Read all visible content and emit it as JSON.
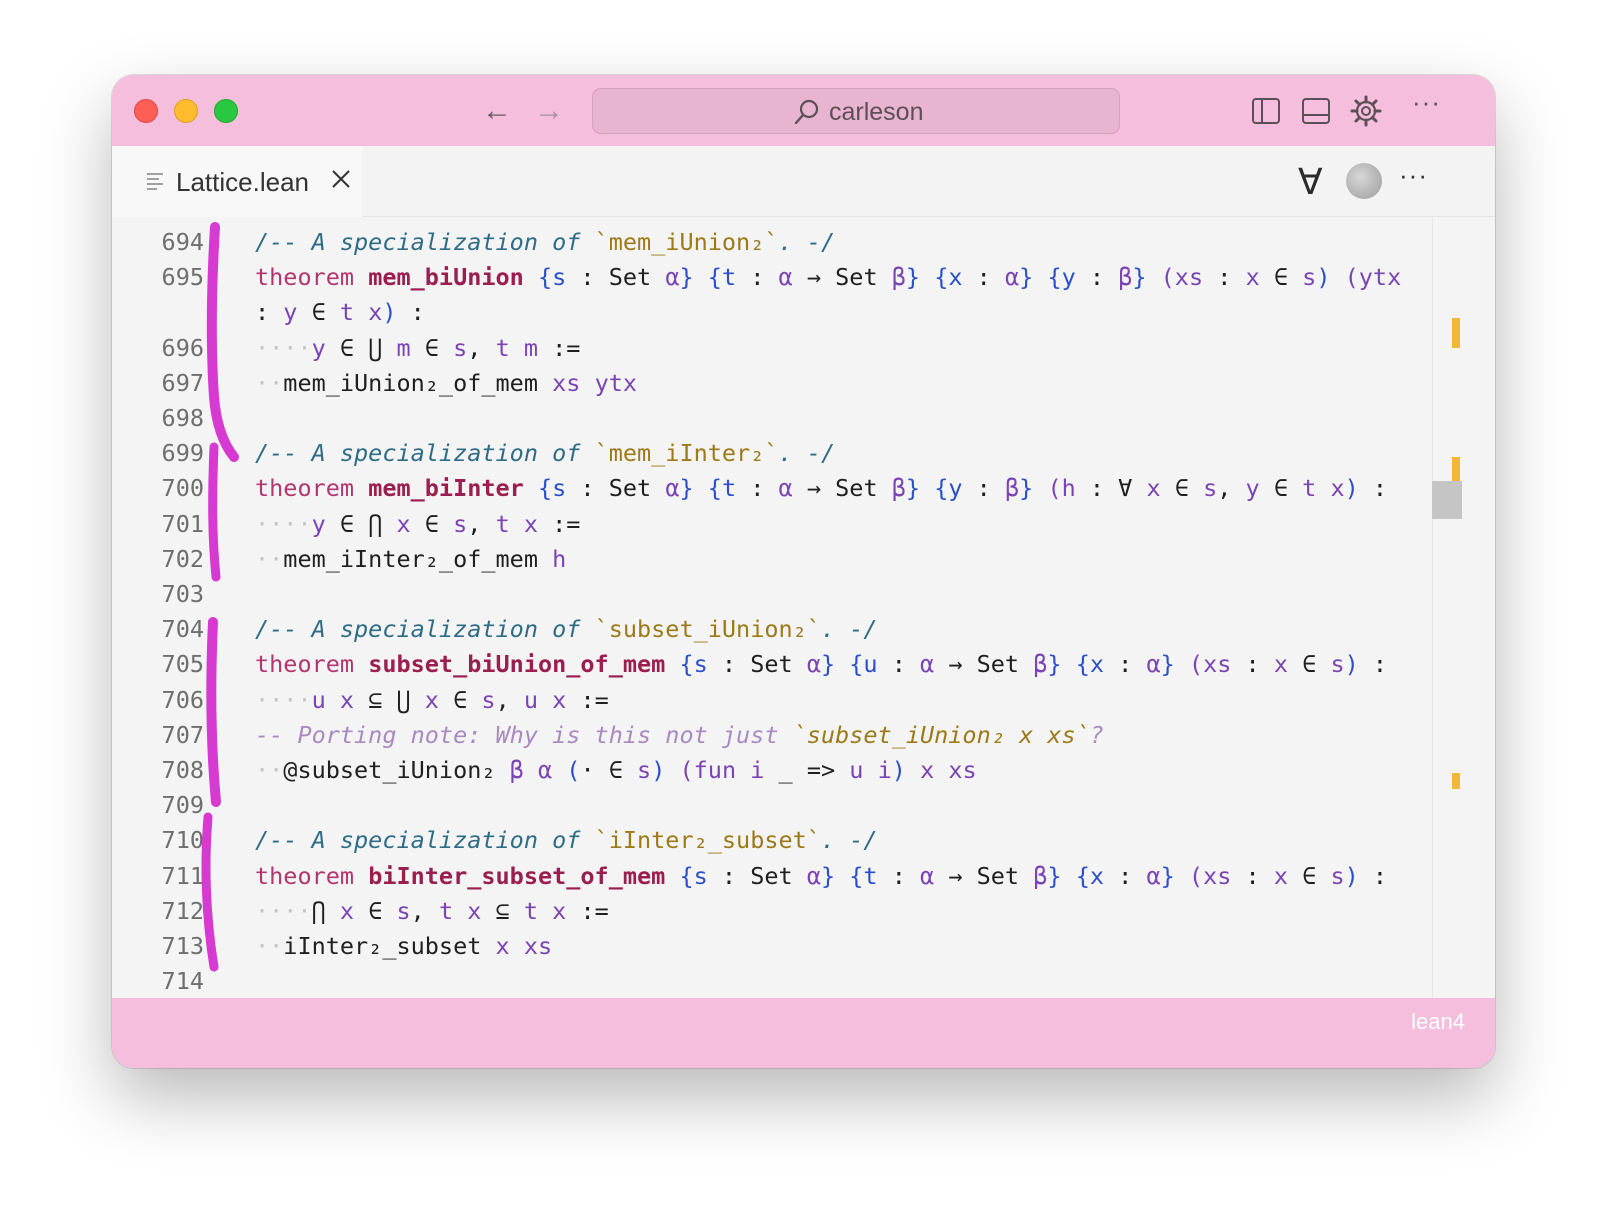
{
  "window": {
    "search": {
      "text": "carleson"
    },
    "status": {
      "language": "lean4"
    }
  },
  "tab": {
    "label": "Lattice.lean"
  },
  "editor": {
    "lines": [
      {
        "ln": "694",
        "tokens": [
          [
            "/-- A specialization of ",
            "tok-comment"
          ],
          [
            "`mem_iUnion₂`",
            "tok-comment-str"
          ],
          [
            ". -/",
            "tok-comment"
          ]
        ]
      },
      {
        "ln": "695",
        "tokens": [
          [
            "theorem ",
            "tok-keyword"
          ],
          [
            "mem_biUnion",
            "tok-name"
          ],
          [
            " ",
            "tok-plain"
          ],
          [
            "{s",
            "tok-brace"
          ],
          [
            " : Set ",
            "tok-plain"
          ],
          [
            "α",
            "tok-var"
          ],
          [
            "}",
            "tok-brace"
          ],
          [
            " ",
            "tok-plain"
          ],
          [
            "{t",
            "tok-brace"
          ],
          [
            " : ",
            "tok-plain"
          ],
          [
            "α",
            "tok-var"
          ],
          [
            " → Set ",
            "tok-plain"
          ],
          [
            "β",
            "tok-var"
          ],
          [
            "}",
            "tok-brace"
          ],
          [
            " ",
            "tok-plain"
          ],
          [
            "{x",
            "tok-brace"
          ],
          [
            " : ",
            "tok-plain"
          ],
          [
            "α",
            "tok-var"
          ],
          [
            "}",
            "tok-brace"
          ],
          [
            " ",
            "tok-plain"
          ],
          [
            "{y",
            "tok-brace"
          ],
          [
            " : ",
            "tok-plain"
          ],
          [
            "β",
            "tok-var"
          ],
          [
            "}",
            "tok-brace"
          ],
          [
            " ",
            "tok-plain"
          ],
          [
            "(xs",
            "tok-var"
          ],
          [
            " : ",
            "tok-plain"
          ],
          [
            "x",
            "tok-var"
          ],
          [
            " ∈ ",
            "tok-plain"
          ],
          [
            "s",
            "tok-var"
          ],
          [
            ")",
            "tok-brace"
          ],
          [
            " ",
            "tok-plain"
          ],
          [
            "(ytx",
            "tok-var"
          ]
        ]
      },
      {
        "ln": "",
        "tokens": [
          [
            ": ",
            "tok-plain"
          ],
          [
            "y",
            "tok-var"
          ],
          [
            " ∈ ",
            "tok-plain"
          ],
          [
            "t x",
            "tok-var"
          ],
          [
            ")",
            "tok-brace"
          ],
          [
            " :",
            "tok-plain"
          ]
        ]
      },
      {
        "ln": "696",
        "tokens": [
          [
            "····",
            "tok-ws"
          ],
          [
            "y",
            "tok-var"
          ],
          [
            " ∈ ⋃ ",
            "tok-plain"
          ],
          [
            "m",
            "tok-var"
          ],
          [
            " ∈ ",
            "tok-plain"
          ],
          [
            "s",
            "tok-var"
          ],
          [
            ", ",
            "tok-plain"
          ],
          [
            "t m",
            "tok-var"
          ],
          [
            " :=",
            "tok-plain"
          ]
        ]
      },
      {
        "ln": "697",
        "tokens": [
          [
            "··",
            "tok-ws"
          ],
          [
            "mem_iUnion₂_of_mem ",
            "tok-plain"
          ],
          [
            "xs ytx",
            "tok-var"
          ]
        ]
      },
      {
        "ln": "698",
        "tokens": []
      },
      {
        "ln": "699",
        "tokens": [
          [
            "/-- A specialization of ",
            "tok-comment"
          ],
          [
            "`mem_iInter₂`",
            "tok-comment-str"
          ],
          [
            ". -/",
            "tok-comment"
          ]
        ]
      },
      {
        "ln": "700",
        "tokens": [
          [
            "theorem ",
            "tok-keyword"
          ],
          [
            "mem_biInter",
            "tok-name"
          ],
          [
            " ",
            "tok-plain"
          ],
          [
            "{s",
            "tok-brace"
          ],
          [
            " : Set ",
            "tok-plain"
          ],
          [
            "α",
            "tok-var"
          ],
          [
            "}",
            "tok-brace"
          ],
          [
            " ",
            "tok-plain"
          ],
          [
            "{t",
            "tok-brace"
          ],
          [
            " : ",
            "tok-plain"
          ],
          [
            "α",
            "tok-var"
          ],
          [
            " → Set ",
            "tok-plain"
          ],
          [
            "β",
            "tok-var"
          ],
          [
            "}",
            "tok-brace"
          ],
          [
            " ",
            "tok-plain"
          ],
          [
            "{y",
            "tok-brace"
          ],
          [
            " : ",
            "tok-plain"
          ],
          [
            "β",
            "tok-var"
          ],
          [
            "}",
            "tok-brace"
          ],
          [
            " ",
            "tok-plain"
          ],
          [
            "(h",
            "tok-var"
          ],
          [
            " : ∀ ",
            "tok-plain"
          ],
          [
            "x",
            "tok-var"
          ],
          [
            " ∈ ",
            "tok-plain"
          ],
          [
            "s",
            "tok-var"
          ],
          [
            ", ",
            "tok-plain"
          ],
          [
            "y",
            "tok-var"
          ],
          [
            " ∈ ",
            "tok-plain"
          ],
          [
            "t x",
            "tok-var"
          ],
          [
            ")",
            "tok-brace"
          ],
          [
            " :",
            "tok-plain"
          ]
        ]
      },
      {
        "ln": "701",
        "tokens": [
          [
            "····",
            "tok-ws"
          ],
          [
            "y",
            "tok-var"
          ],
          [
            " ∈ ⋂ ",
            "tok-plain"
          ],
          [
            "x",
            "tok-var"
          ],
          [
            " ∈ ",
            "tok-plain"
          ],
          [
            "s",
            "tok-var"
          ],
          [
            ", ",
            "tok-plain"
          ],
          [
            "t x",
            "tok-var"
          ],
          [
            " :=",
            "tok-plain"
          ]
        ]
      },
      {
        "ln": "702",
        "tokens": [
          [
            "··",
            "tok-ws"
          ],
          [
            "mem_iInter₂_of_mem ",
            "tok-plain"
          ],
          [
            "h",
            "tok-var"
          ]
        ]
      },
      {
        "ln": "703",
        "tokens": []
      },
      {
        "ln": "704",
        "tokens": [
          [
            "/-- A specialization of ",
            "tok-comment"
          ],
          [
            "`subset_iUnion₂`",
            "tok-comment-str"
          ],
          [
            ". -/",
            "tok-comment"
          ]
        ]
      },
      {
        "ln": "705",
        "tokens": [
          [
            "theorem ",
            "tok-keyword"
          ],
          [
            "subset_biUnion_of_mem",
            "tok-name"
          ],
          [
            " ",
            "tok-plain"
          ],
          [
            "{s",
            "tok-brace"
          ],
          [
            " : Set ",
            "tok-plain"
          ],
          [
            "α",
            "tok-var"
          ],
          [
            "}",
            "tok-brace"
          ],
          [
            " ",
            "tok-plain"
          ],
          [
            "{u",
            "tok-brace"
          ],
          [
            " : ",
            "tok-plain"
          ],
          [
            "α",
            "tok-var"
          ],
          [
            " → Set ",
            "tok-plain"
          ],
          [
            "β",
            "tok-var"
          ],
          [
            "}",
            "tok-brace"
          ],
          [
            " ",
            "tok-plain"
          ],
          [
            "{x",
            "tok-brace"
          ],
          [
            " : ",
            "tok-plain"
          ],
          [
            "α",
            "tok-var"
          ],
          [
            "}",
            "tok-brace"
          ],
          [
            " ",
            "tok-plain"
          ],
          [
            "(xs",
            "tok-var"
          ],
          [
            " : ",
            "tok-plain"
          ],
          [
            "x",
            "tok-var"
          ],
          [
            " ∈ ",
            "tok-plain"
          ],
          [
            "s",
            "tok-var"
          ],
          [
            ")",
            "tok-brace"
          ],
          [
            " :",
            "tok-plain"
          ]
        ]
      },
      {
        "ln": "706",
        "tokens": [
          [
            "····",
            "tok-ws"
          ],
          [
            "u x",
            "tok-var"
          ],
          [
            " ⊆ ⋃ ",
            "tok-plain"
          ],
          [
            "x",
            "tok-var"
          ],
          [
            " ∈ ",
            "tok-plain"
          ],
          [
            "s",
            "tok-var"
          ],
          [
            ", ",
            "tok-plain"
          ],
          [
            "u x",
            "tok-var"
          ],
          [
            " :=",
            "tok-plain"
          ]
        ]
      },
      {
        "ln": "707",
        "tokens": [
          [
            "-- Porting note: Why is this not just ",
            "tok-note"
          ],
          [
            "`subset_iUnion₂ x xs`",
            "tok-note-str"
          ],
          [
            "?",
            "tok-note"
          ]
        ]
      },
      {
        "ln": "708",
        "tokens": [
          [
            "··",
            "tok-ws"
          ],
          [
            "@subset_iUnion₂ ",
            "tok-plain"
          ],
          [
            "β α",
            "tok-var"
          ],
          [
            " ",
            "tok-plain"
          ],
          [
            "(",
            "tok-brace"
          ],
          [
            "· ∈ ",
            "tok-plain"
          ],
          [
            "s",
            "tok-var"
          ],
          [
            ")",
            "tok-brace"
          ],
          [
            " ",
            "tok-plain"
          ],
          [
            "(fun",
            "tok-var"
          ],
          [
            " ",
            "tok-plain"
          ],
          [
            "i",
            "tok-var"
          ],
          [
            " _ => ",
            "tok-plain"
          ],
          [
            "u i",
            "tok-var"
          ],
          [
            ")",
            "tok-brace"
          ],
          [
            " ",
            "tok-plain"
          ],
          [
            "x xs",
            "tok-var"
          ]
        ]
      },
      {
        "ln": "709",
        "tokens": []
      },
      {
        "ln": "710",
        "tokens": [
          [
            "/-- A specialization of ",
            "tok-comment"
          ],
          [
            "`iInter₂_subset`",
            "tok-comment-str"
          ],
          [
            ". -/",
            "tok-comment"
          ]
        ]
      },
      {
        "ln": "711",
        "tokens": [
          [
            "theorem ",
            "tok-keyword"
          ],
          [
            "biInter_subset_of_mem",
            "tok-name"
          ],
          [
            " ",
            "tok-plain"
          ],
          [
            "{s",
            "tok-brace"
          ],
          [
            " : Set ",
            "tok-plain"
          ],
          [
            "α",
            "tok-var"
          ],
          [
            "}",
            "tok-brace"
          ],
          [
            " ",
            "tok-plain"
          ],
          [
            "{t",
            "tok-brace"
          ],
          [
            " : ",
            "tok-plain"
          ],
          [
            "α",
            "tok-var"
          ],
          [
            " → Set ",
            "tok-plain"
          ],
          [
            "β",
            "tok-var"
          ],
          [
            "}",
            "tok-brace"
          ],
          [
            " ",
            "tok-plain"
          ],
          [
            "{x",
            "tok-brace"
          ],
          [
            " : ",
            "tok-plain"
          ],
          [
            "α",
            "tok-var"
          ],
          [
            "}",
            "tok-brace"
          ],
          [
            " ",
            "tok-plain"
          ],
          [
            "(xs",
            "tok-var"
          ],
          [
            " : ",
            "tok-plain"
          ],
          [
            "x",
            "tok-var"
          ],
          [
            " ∈ ",
            "tok-plain"
          ],
          [
            "s",
            "tok-var"
          ],
          [
            ")",
            "tok-brace"
          ],
          [
            " :",
            "tok-plain"
          ]
        ]
      },
      {
        "ln": "712",
        "tokens": [
          [
            "····",
            "tok-ws"
          ],
          [
            "⋂ ",
            "tok-plain"
          ],
          [
            "x",
            "tok-var"
          ],
          [
            " ∈ ",
            "tok-plain"
          ],
          [
            "s",
            "tok-var"
          ],
          [
            ", ",
            "tok-plain"
          ],
          [
            "t x",
            "tok-var"
          ],
          [
            " ⊆ ",
            "tok-plain"
          ],
          [
            "t x",
            "tok-var"
          ],
          [
            " :=",
            "tok-plain"
          ]
        ]
      },
      {
        "ln": "713",
        "tokens": [
          [
            "··",
            "tok-ws"
          ],
          [
            "iInter₂_subset ",
            "tok-plain"
          ],
          [
            "x xs",
            "tok-var"
          ]
        ]
      },
      {
        "ln": "714",
        "tokens": []
      }
    ]
  },
  "colors": {
    "titlebar": "#f4bedc",
    "annotation": "#d63ad0",
    "keyword": "#b2366e"
  }
}
